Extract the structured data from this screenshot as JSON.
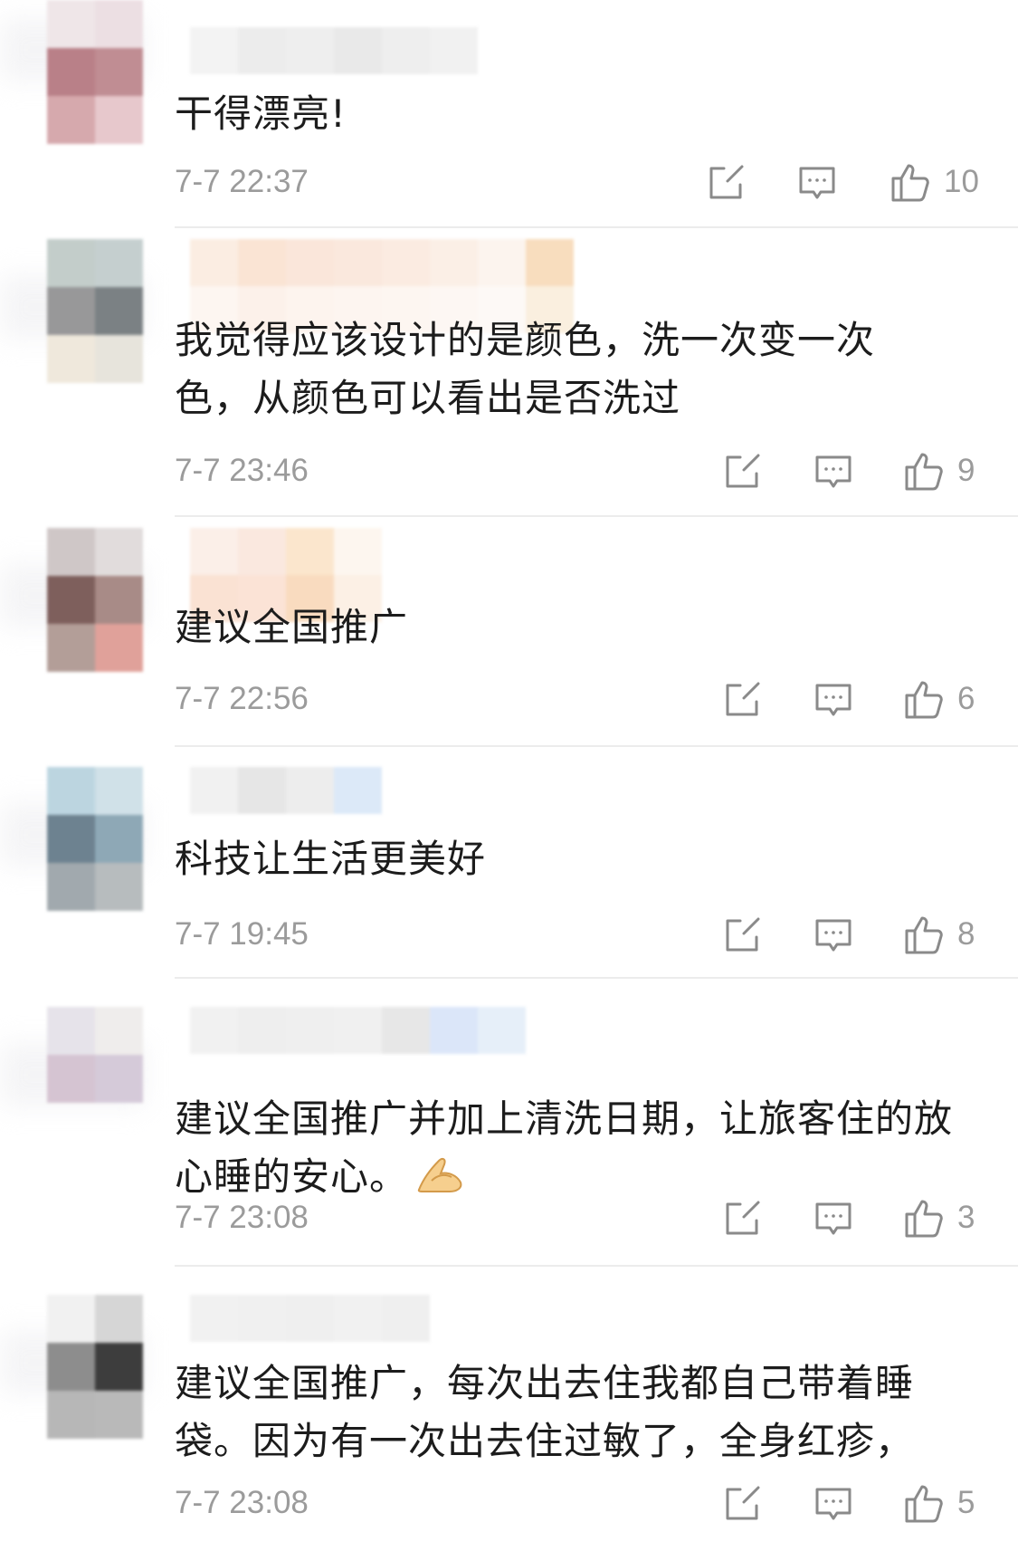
{
  "comments": [
    {
      "text": "干得漂亮!",
      "text_emoji": "",
      "time": "7-7 22:37",
      "likes": "10"
    },
    {
      "text": "我觉得应该设计的是颜色，洗一次变一次色，从颜色可以看出是否洗过",
      "text_emoji": "",
      "time": "7-7 23:46",
      "likes": "9"
    },
    {
      "text": "建议全国推广",
      "text_emoji": "",
      "time": "7-7 22:56",
      "likes": "6"
    },
    {
      "text": "科技让生活更美好",
      "text_emoji": "",
      "time": "7-7 19:45",
      "likes": "8"
    },
    {
      "text": "建议全国推广并加上清洗日期，让旅客住的放心睡的安心。",
      "text_emoji": "pray-hands-emoji",
      "time": "7-7 23:08",
      "likes": "3"
    },
    {
      "text": "建议全国推广，每次出去住我都自己带着睡袋。因为有一次出去住过敏了，全身红疹，",
      "text_emoji": "",
      "time": "7-7 23:08",
      "likes": "5"
    }
  ],
  "icons": {
    "share": "share-icon",
    "reply": "reply-icon",
    "like": "thumbs-up-icon"
  },
  "colors": {
    "text": "#1c1c1c",
    "meta": "#9b9b9b",
    "icon": "#8a8a8a",
    "divider": "#ececec"
  }
}
